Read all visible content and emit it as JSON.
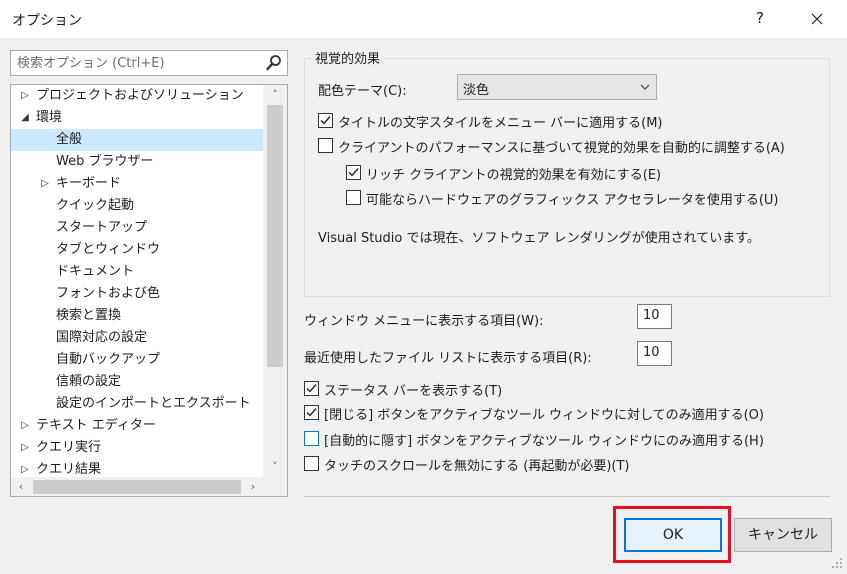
{
  "window": {
    "title": "オプション",
    "help_glyph": "?",
    "close_icon": "close-icon"
  },
  "search": {
    "placeholder": "検索オプション (Ctrl+E)"
  },
  "tree": {
    "items": [
      {
        "label": "プロジェクトおよびソリューション",
        "expander": "collapsed",
        "level": 0
      },
      {
        "label": "環境",
        "expander": "expanded",
        "level": 0
      },
      {
        "label": "全般",
        "expander": "none",
        "level": 1,
        "selected": true
      },
      {
        "label": "Web ブラウザー",
        "expander": "none",
        "level": 1
      },
      {
        "label": "キーボード",
        "expander": "collapsed",
        "level": 1
      },
      {
        "label": "クイック起動",
        "expander": "none",
        "level": 1
      },
      {
        "label": "スタートアップ",
        "expander": "none",
        "level": 1
      },
      {
        "label": "タブとウィンドウ",
        "expander": "none",
        "level": 1
      },
      {
        "label": "ドキュメント",
        "expander": "none",
        "level": 1
      },
      {
        "label": "フォントおよび色",
        "expander": "none",
        "level": 1
      },
      {
        "label": "検索と置換",
        "expander": "none",
        "level": 1
      },
      {
        "label": "国際対応の設定",
        "expander": "none",
        "level": 1
      },
      {
        "label": "自動バックアップ",
        "expander": "none",
        "level": 1
      },
      {
        "label": "信頼の設定",
        "expander": "none",
        "level": 1
      },
      {
        "label": "設定のインポートとエクスポート",
        "expander": "none",
        "level": 1
      },
      {
        "label": "テキスト エディター",
        "expander": "collapsed",
        "level": 0
      },
      {
        "label": "クエリ実行",
        "expander": "collapsed",
        "level": 0
      },
      {
        "label": "クエリ結果",
        "expander": "collapsed",
        "level": 0
      }
    ]
  },
  "visual_effects": {
    "group_title": "視覚的効果",
    "theme_label": "配色テーマ(C):",
    "theme_value": "淡色",
    "checkboxes": [
      {
        "label": "タイトルの文字スタイルをメニュー バーに適用する(M)",
        "checked": true
      },
      {
        "label": "クライアントのパフォーマンスに基づいて視覚的効果を自動的に調整する(A)",
        "checked": false
      },
      {
        "label": "リッチ クライアントの視覚的効果を有効にする(E)",
        "checked": true
      },
      {
        "label": "可能ならハードウェアのグラフィックス アクセラレータを使用する(U)",
        "checked": false
      }
    ],
    "info_text": "Visual Studio では現在、ソフトウェア レンダリングが使用されています。"
  },
  "window_menu": {
    "label": "ウィンドウ メニューに表示する項目(W):",
    "value": "10"
  },
  "recent_files": {
    "label": "最近使用したファイル リストに表示する項目(R):",
    "value": "10"
  },
  "general_checkboxes": [
    {
      "label": "ステータス バーを表示する(T)",
      "checked": true
    },
    {
      "label": "[閉じる] ボタンをアクティブなツール ウィンドウに対してのみ適用する(O)",
      "checked": true
    },
    {
      "label": "[自動的に隠す] ボタンをアクティブなツール ウィンドウにのみ適用する(H)",
      "checked": false,
      "focused": true
    },
    {
      "label": "タッチのスクロールを無効にする (再起動が必要)(T)",
      "checked": false
    }
  ],
  "buttons": {
    "ok": "OK",
    "cancel": "キャンセル"
  },
  "colors": {
    "selection": "#cce8ff",
    "focus_border": "#0078d7",
    "highlight_outline": "#e81123"
  }
}
